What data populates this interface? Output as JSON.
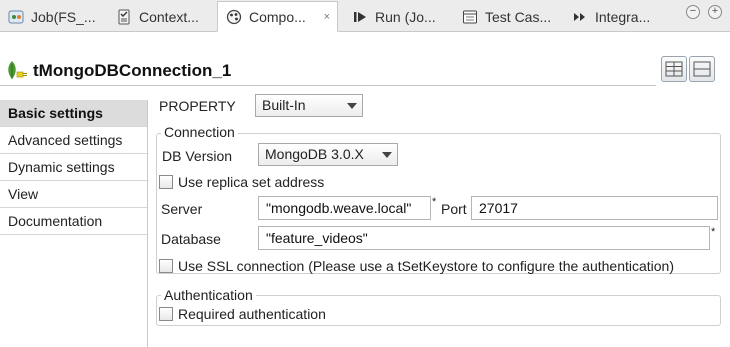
{
  "tabs": [
    {
      "label": "Job(FS_...",
      "icon": "job-icon"
    },
    {
      "label": "Context...",
      "icon": "context-icon"
    },
    {
      "label": "Compo...",
      "icon": "component-icon",
      "active": true
    },
    {
      "label": "Run (Jo...",
      "icon": "run-icon"
    },
    {
      "label": "Test Cas...",
      "icon": "test-case-icon"
    },
    {
      "label": "Integra...",
      "icon": "integration-icon"
    }
  ],
  "tab_close": "×",
  "window_controls": {
    "minimize": "−",
    "maximize": "+"
  },
  "component": {
    "title": "tMongoDBConnection_1",
    "icon": "mongodb-leaf-icon"
  },
  "nav": {
    "items": [
      {
        "label": "Basic settings",
        "active": true
      },
      {
        "label": "Advanced settings"
      },
      {
        "label": "Dynamic settings"
      },
      {
        "label": "View"
      },
      {
        "label": "Documentation"
      }
    ]
  },
  "property": {
    "label": "PROPERTY",
    "value": "Built-In"
  },
  "connection": {
    "group_title": "Connection",
    "db_version_label": "DB Version",
    "db_version_value": "MongoDB 3.0.X",
    "replica_label": "Use replica set address",
    "replica_checked": false,
    "server_label": "Server",
    "server_value": "\"mongodb.weave.local\"",
    "port_label": "Port",
    "port_value": "27017",
    "database_label": "Database",
    "database_value": "\"feature_videos\"",
    "required_marker": "*",
    "ssl_label": "Use SSL connection (Please use a tSetKeystore to configure the authentication)",
    "ssl_checked": false
  },
  "authentication": {
    "group_title": "Authentication",
    "required_auth_label": "Required authentication",
    "required_auth_checked": false
  },
  "colors": {
    "active_nav_bg": "#dcdcdc",
    "tab_bar_bg": "#ececec",
    "mongodb_green": "#4a9a2f",
    "connector_yellow": "#e8d21a"
  }
}
